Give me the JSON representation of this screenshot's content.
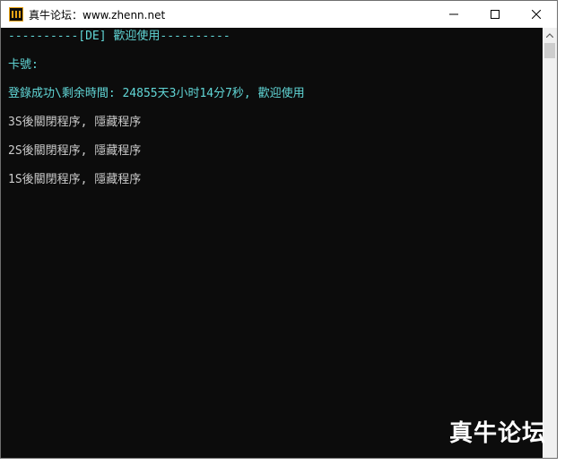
{
  "window": {
    "title": "真牛论坛：www.zhenn.net"
  },
  "console": {
    "lines": [
      "----------[DE] 歡迎使用----------",
      "卡號:",
      "登錄成功\\剩余時間: 24855天3小时14分7秒, 歡迎使用",
      "3S後關閉程序, 隱藏程序",
      "2S後關閉程序, 隱藏程序",
      "1S後關閉程序, 隱藏程序"
    ]
  },
  "watermark": {
    "text": "真牛论坛"
  },
  "colors": {
    "console_background": "#0c0c0c",
    "console_text_teal": "#61d6d6",
    "console_text_gray": "#cccccc",
    "titlebar_background": "#ffffff"
  }
}
